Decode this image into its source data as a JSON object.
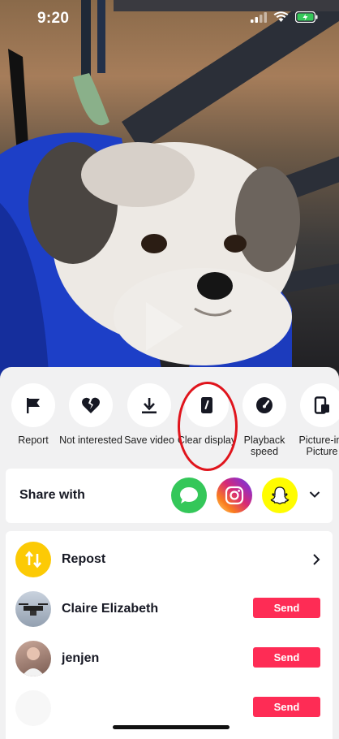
{
  "status_bar": {
    "time": "9:20"
  },
  "actions": [
    {
      "label": "Report",
      "icon": "flag-icon"
    },
    {
      "label": "Not interested",
      "icon": "broken-heart-icon"
    },
    {
      "label": "Save video",
      "icon": "download-icon"
    },
    {
      "label": "Clear display",
      "icon": "clear-display-icon",
      "highlighted": true
    },
    {
      "label": "Playback speed",
      "icon": "speedometer-icon"
    },
    {
      "label": "Picture-in-Picture",
      "icon": "picture-in-picture-icon"
    }
  ],
  "share": {
    "title": "Share with",
    "apps": [
      {
        "icon": "messages-icon",
        "color": "#34c759"
      },
      {
        "icon": "instagram-icon",
        "color": "#d62976"
      },
      {
        "icon": "snapchat-icon",
        "color": "#fffc00"
      }
    ]
  },
  "list": {
    "repost": {
      "label": "Repost",
      "color": "#fcca05"
    },
    "contacts": [
      {
        "name": "Claire Elizabeth",
        "button": "Send"
      },
      {
        "name": "jenjen",
        "button": "Send"
      },
      {
        "name": "",
        "button": "Send"
      }
    ]
  },
  "colors": {
    "send": "#fe2c55",
    "highlight_oval": "#e0141c"
  }
}
